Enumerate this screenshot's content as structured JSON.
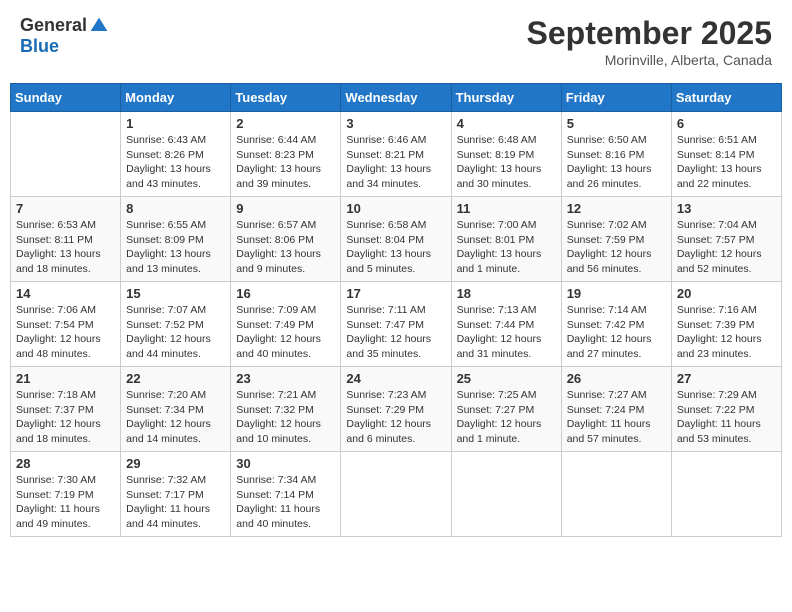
{
  "header": {
    "logo_general": "General",
    "logo_blue": "Blue",
    "month_title": "September 2025",
    "location": "Morinville, Alberta, Canada"
  },
  "days_of_week": [
    "Sunday",
    "Monday",
    "Tuesday",
    "Wednesday",
    "Thursday",
    "Friday",
    "Saturday"
  ],
  "weeks": [
    [
      {
        "day": "",
        "info": ""
      },
      {
        "day": "1",
        "info": "Sunrise: 6:43 AM\nSunset: 8:26 PM\nDaylight: 13 hours\nand 43 minutes."
      },
      {
        "day": "2",
        "info": "Sunrise: 6:44 AM\nSunset: 8:23 PM\nDaylight: 13 hours\nand 39 minutes."
      },
      {
        "day": "3",
        "info": "Sunrise: 6:46 AM\nSunset: 8:21 PM\nDaylight: 13 hours\nand 34 minutes."
      },
      {
        "day": "4",
        "info": "Sunrise: 6:48 AM\nSunset: 8:19 PM\nDaylight: 13 hours\nand 30 minutes."
      },
      {
        "day": "5",
        "info": "Sunrise: 6:50 AM\nSunset: 8:16 PM\nDaylight: 13 hours\nand 26 minutes."
      },
      {
        "day": "6",
        "info": "Sunrise: 6:51 AM\nSunset: 8:14 PM\nDaylight: 13 hours\nand 22 minutes."
      }
    ],
    [
      {
        "day": "7",
        "info": "Sunrise: 6:53 AM\nSunset: 8:11 PM\nDaylight: 13 hours\nand 18 minutes."
      },
      {
        "day": "8",
        "info": "Sunrise: 6:55 AM\nSunset: 8:09 PM\nDaylight: 13 hours\nand 13 minutes."
      },
      {
        "day": "9",
        "info": "Sunrise: 6:57 AM\nSunset: 8:06 PM\nDaylight: 13 hours\nand 9 minutes."
      },
      {
        "day": "10",
        "info": "Sunrise: 6:58 AM\nSunset: 8:04 PM\nDaylight: 13 hours\nand 5 minutes."
      },
      {
        "day": "11",
        "info": "Sunrise: 7:00 AM\nSunset: 8:01 PM\nDaylight: 13 hours\nand 1 minute."
      },
      {
        "day": "12",
        "info": "Sunrise: 7:02 AM\nSunset: 7:59 PM\nDaylight: 12 hours\nand 56 minutes."
      },
      {
        "day": "13",
        "info": "Sunrise: 7:04 AM\nSunset: 7:57 PM\nDaylight: 12 hours\nand 52 minutes."
      }
    ],
    [
      {
        "day": "14",
        "info": "Sunrise: 7:06 AM\nSunset: 7:54 PM\nDaylight: 12 hours\nand 48 minutes."
      },
      {
        "day": "15",
        "info": "Sunrise: 7:07 AM\nSunset: 7:52 PM\nDaylight: 12 hours\nand 44 minutes."
      },
      {
        "day": "16",
        "info": "Sunrise: 7:09 AM\nSunset: 7:49 PM\nDaylight: 12 hours\nand 40 minutes."
      },
      {
        "day": "17",
        "info": "Sunrise: 7:11 AM\nSunset: 7:47 PM\nDaylight: 12 hours\nand 35 minutes."
      },
      {
        "day": "18",
        "info": "Sunrise: 7:13 AM\nSunset: 7:44 PM\nDaylight: 12 hours\nand 31 minutes."
      },
      {
        "day": "19",
        "info": "Sunrise: 7:14 AM\nSunset: 7:42 PM\nDaylight: 12 hours\nand 27 minutes."
      },
      {
        "day": "20",
        "info": "Sunrise: 7:16 AM\nSunset: 7:39 PM\nDaylight: 12 hours\nand 23 minutes."
      }
    ],
    [
      {
        "day": "21",
        "info": "Sunrise: 7:18 AM\nSunset: 7:37 PM\nDaylight: 12 hours\nand 18 minutes."
      },
      {
        "day": "22",
        "info": "Sunrise: 7:20 AM\nSunset: 7:34 PM\nDaylight: 12 hours\nand 14 minutes."
      },
      {
        "day": "23",
        "info": "Sunrise: 7:21 AM\nSunset: 7:32 PM\nDaylight: 12 hours\nand 10 minutes."
      },
      {
        "day": "24",
        "info": "Sunrise: 7:23 AM\nSunset: 7:29 PM\nDaylight: 12 hours\nand 6 minutes."
      },
      {
        "day": "25",
        "info": "Sunrise: 7:25 AM\nSunset: 7:27 PM\nDaylight: 12 hours\nand 1 minute."
      },
      {
        "day": "26",
        "info": "Sunrise: 7:27 AM\nSunset: 7:24 PM\nDaylight: 11 hours\nand 57 minutes."
      },
      {
        "day": "27",
        "info": "Sunrise: 7:29 AM\nSunset: 7:22 PM\nDaylight: 11 hours\nand 53 minutes."
      }
    ],
    [
      {
        "day": "28",
        "info": "Sunrise: 7:30 AM\nSunset: 7:19 PM\nDaylight: 11 hours\nand 49 minutes."
      },
      {
        "day": "29",
        "info": "Sunrise: 7:32 AM\nSunset: 7:17 PM\nDaylight: 11 hours\nand 44 minutes."
      },
      {
        "day": "30",
        "info": "Sunrise: 7:34 AM\nSunset: 7:14 PM\nDaylight: 11 hours\nand 40 minutes."
      },
      {
        "day": "",
        "info": ""
      },
      {
        "day": "",
        "info": ""
      },
      {
        "day": "",
        "info": ""
      },
      {
        "day": "",
        "info": ""
      }
    ]
  ]
}
